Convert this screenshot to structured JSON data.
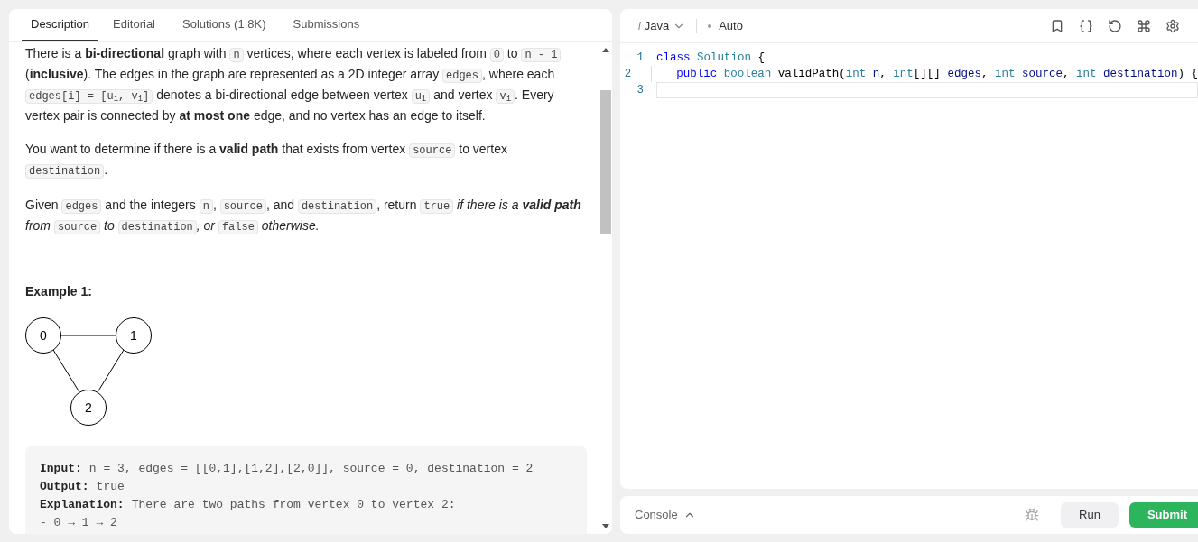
{
  "tabs": [
    {
      "label": "Description",
      "selected": true
    },
    {
      "label": "Editorial",
      "selected": false
    },
    {
      "label": "Solutions (1.8K)",
      "selected": false
    },
    {
      "label": "Submissions",
      "selected": false
    }
  ],
  "description": {
    "paragraphs": [
      [
        {
          "kind": "text",
          "text": "There is a **bi-directional** graph with "
        },
        {
          "kind": "code",
          "text": "n"
        },
        {
          "kind": "text",
          "text": " vertices, where each vertex is labeled from "
        },
        {
          "kind": "code",
          "text": "0"
        },
        {
          "kind": "text",
          "text": " to "
        },
        {
          "kind": "code",
          "text": "n - 1"
        },
        {
          "kind": "text",
          "text": " (**inclusive**). The edges in the graph are represented as a 2D integer array "
        },
        {
          "kind": "code",
          "text": "edges"
        },
        {
          "kind": "text",
          "text": ", where each "
        },
        {
          "kind": "code",
          "text": "edges[i] = [u$_{i}$, v$_{i}$]"
        },
        {
          "kind": "text",
          "text": " denotes a bi-directional edge between vertex "
        },
        {
          "kind": "code",
          "text": "u$_{i}$"
        },
        {
          "kind": "text",
          "text": " and vertex "
        },
        {
          "kind": "code",
          "text": "v$_{i}$"
        },
        {
          "kind": "text",
          "text": ". Every vertex pair is connected by **at most one** edge, and no vertex has an edge to itself."
        }
      ],
      [
        {
          "kind": "text",
          "text": "You want to determine if there is a **valid path** that exists from vertex "
        },
        {
          "kind": "code",
          "text": "source"
        },
        {
          "kind": "text",
          "text": " to vertex "
        },
        {
          "kind": "code",
          "text": "destination"
        },
        {
          "kind": "text",
          "text": "."
        }
      ],
      [
        {
          "kind": "text",
          "text": "Given "
        },
        {
          "kind": "code",
          "text": "edges"
        },
        {
          "kind": "text",
          "text": " and the integers "
        },
        {
          "kind": "code",
          "text": "n"
        },
        {
          "kind": "text",
          "text": ", "
        },
        {
          "kind": "code",
          "text": "source"
        },
        {
          "kind": "text",
          "text": ", and "
        },
        {
          "kind": "code",
          "text": "destination"
        },
        {
          "kind": "text",
          "text": ", return "
        },
        {
          "kind": "code",
          "text": "true"
        },
        {
          "kind": "italic",
          "text": " if there is a **valid path** from "
        },
        {
          "kind": "code",
          "text": "source"
        },
        {
          "kind": "italic",
          "text": " to "
        },
        {
          "kind": "code",
          "text": "destination"
        },
        {
          "kind": "italic",
          "text": ", or "
        },
        {
          "kind": "code",
          "text": "false"
        },
        {
          "kind": "italic",
          "text": " otherwise."
        }
      ]
    ],
    "example": {
      "title": "Example 1:",
      "graph_nodes": [
        "0",
        "1",
        "2"
      ],
      "lines": [
        {
          "label": "Input:",
          "value": "n = 3, edges = [[0,1],[1,2],[2,0]], source = 0, destination = 2"
        },
        {
          "label": "Output:",
          "value": "true"
        },
        {
          "label": "Explanation:",
          "value": "There are two paths from vertex 0 to vertex 2:"
        },
        {
          "value": "- 0 → 1 → 2"
        }
      ]
    }
  },
  "editor": {
    "language_icon": "i",
    "language": "Java",
    "mode": "Auto",
    "lines": [
      {
        "number": "1",
        "tokens": [
          {
            "kind": "keyword",
            "text": "class"
          },
          {
            "kind": "type",
            "text": " Solution"
          },
          {
            "kind": "plain",
            "text": " {"
          }
        ]
      },
      {
        "number": "2",
        "indent": true,
        "tokens": [
          {
            "kind": "keyword",
            "text": "public"
          },
          {
            "kind": "type",
            "text": " boolean"
          },
          {
            "kind": "plain",
            "text": " validPath("
          },
          {
            "kind": "type",
            "text": "int"
          },
          {
            "kind": "ident",
            "text": " n"
          },
          {
            "kind": "plain",
            "text": ", "
          },
          {
            "kind": "type",
            "text": "int"
          },
          {
            "kind": "plain",
            "text": "[][] "
          },
          {
            "kind": "ident",
            "text": "edges"
          },
          {
            "kind": "plain",
            "text": ", "
          },
          {
            "kind": "type",
            "text": "int"
          },
          {
            "kind": "ident",
            "text": " source"
          },
          {
            "kind": "plain",
            "text": ", "
          },
          {
            "kind": "type",
            "text": "int"
          },
          {
            "kind": "ident",
            "text": " destination"
          },
          {
            "kind": "plain",
            "text": ") {"
          }
        ]
      },
      {
        "number": "3",
        "current": true
      }
    ]
  },
  "console": {
    "label": "Console",
    "buttons": [
      {
        "label": "Run",
        "kind": "secondary"
      },
      {
        "label": "Submit",
        "kind": "primary"
      }
    ]
  }
}
